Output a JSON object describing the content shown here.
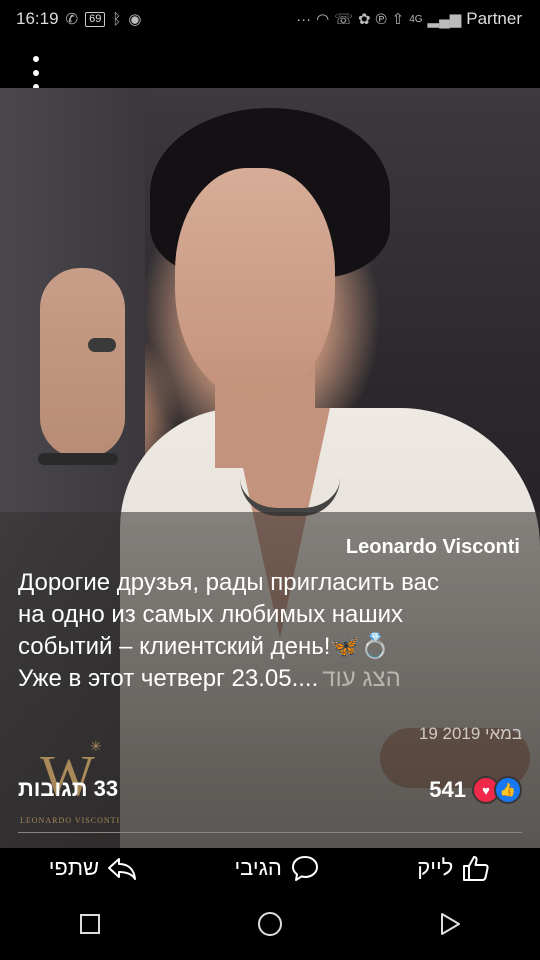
{
  "status_bar": {
    "time": "16:19",
    "battery": "69",
    "carrier": "Partner",
    "network": "4G",
    "left_icons": [
      "missed-call-icon",
      "battery-icon",
      "bluetooth-icon",
      "eye-icon"
    ],
    "right_icons": [
      "more-dots-icon",
      "wifi-icon",
      "viber-icon",
      "app-icon",
      "pinterest-icon",
      "upload-icon",
      "signal-icon"
    ]
  },
  "post": {
    "author": "Leonardo Visconti",
    "text_lines": [
      "Дорогие друзья, рады пригласить вас",
      "на одно из самых любимых наших",
      "событий – клиентский день!🦋💍",
      "Уже в этот четверг 23.05...."
    ],
    "see_more": "הצג עוד",
    "date": "19 במאי 2019",
    "logo_letter": "W",
    "logo_text": "LEONARDO VISCONTI",
    "comments": "33 תגובות",
    "reactions_count": "541",
    "reaction_icons": [
      "heart-icon",
      "like-icon"
    ]
  },
  "actions": {
    "like": "לייק",
    "comment": "הגיבי",
    "share": "שתפי"
  },
  "nav": {
    "recent": "square-icon",
    "home": "circle-icon",
    "back": "triangle-icon"
  },
  "colors": {
    "heart": "#f0284a",
    "like": "#1877f2",
    "logo_gold": "#a8895a"
  }
}
